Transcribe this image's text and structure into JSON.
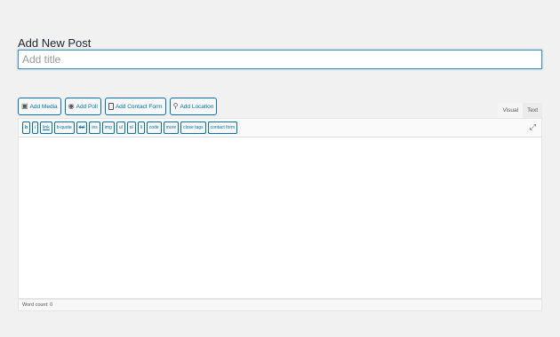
{
  "page": {
    "title": "Add New Post"
  },
  "title_field": {
    "value": "",
    "placeholder": "Add title"
  },
  "media_buttons": [
    {
      "label": "Add Media",
      "icon": "media-icon"
    },
    {
      "label": "Add Poll",
      "icon": "poll-icon"
    },
    {
      "label": "Add Contact Form",
      "icon": "form-icon"
    },
    {
      "label": "Add Location",
      "icon": "location-pin-icon"
    }
  ],
  "editor_tabs": {
    "visual": "Visual",
    "text": "Text",
    "active": "Visual"
  },
  "quicktags": [
    "b",
    "i",
    "link",
    "b-quote",
    "del",
    "ins",
    "img",
    "ul",
    "ol",
    "li",
    "code",
    "more",
    "close tags",
    "contact form"
  ],
  "content": {
    "value": ""
  },
  "status": {
    "word_count": "Word count: 0"
  },
  "colors": {
    "accent": "#0073aa",
    "background": "#f1f1f1",
    "focus_border": "#4a90c2"
  }
}
